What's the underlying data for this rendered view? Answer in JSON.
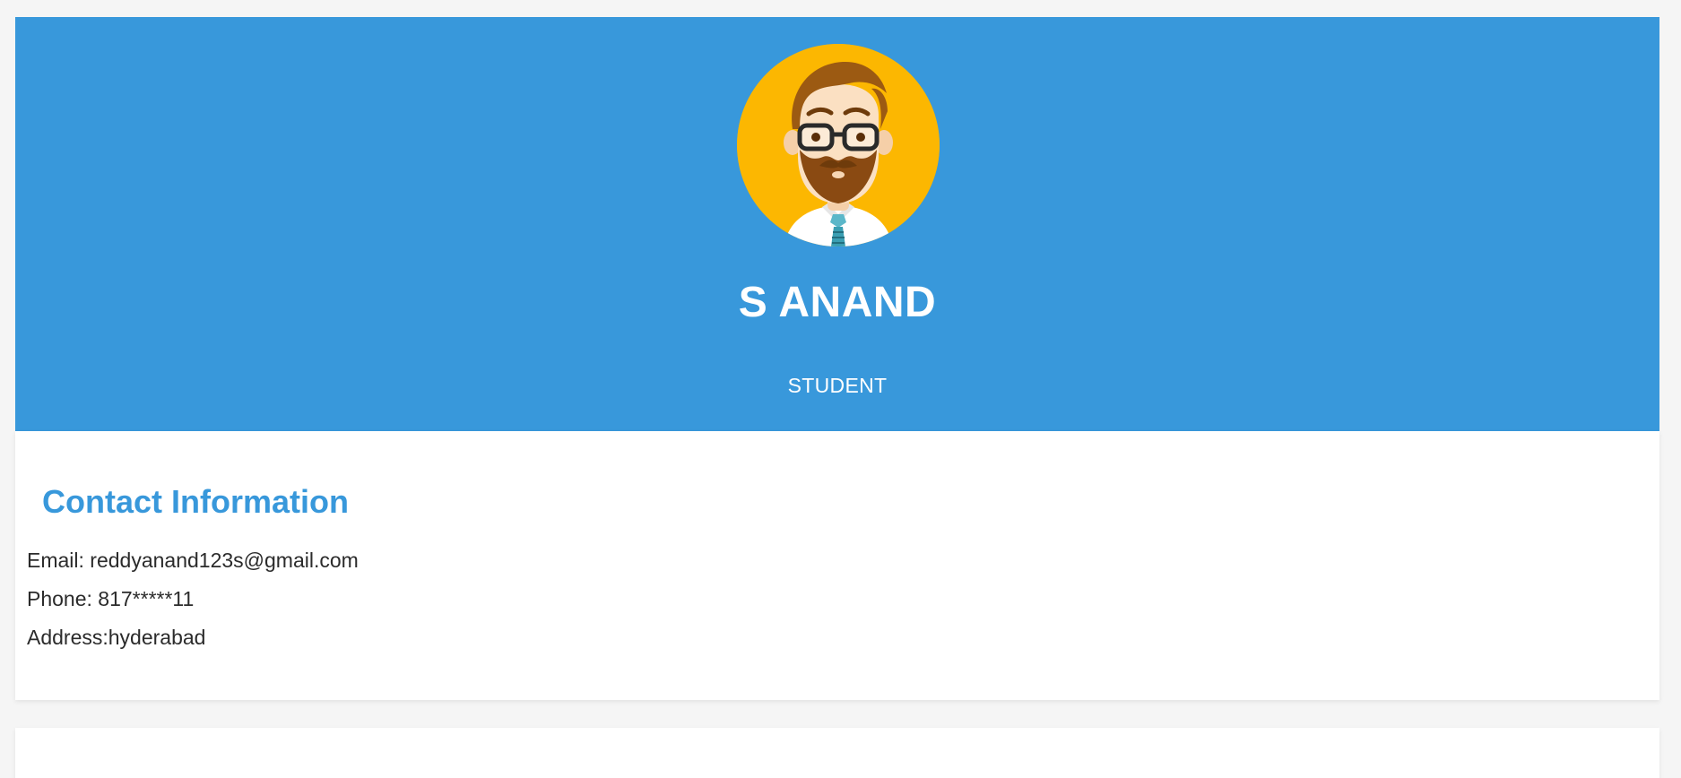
{
  "profile": {
    "name": "S ANAND",
    "role": "STUDENT"
  },
  "contact": {
    "title": "Contact Information",
    "email": "Email: reddyanand123s@gmail.com",
    "phone": "Phone: 817*****11",
    "address": "Address:hyderabad"
  },
  "icons": {
    "avatar": "bearded-man-avatar-icon"
  },
  "colors": {
    "header_bg": "#3898db",
    "accent": "#3898db",
    "avatar_bg": "#fcb701",
    "page_bg": "#f5f5f5"
  }
}
